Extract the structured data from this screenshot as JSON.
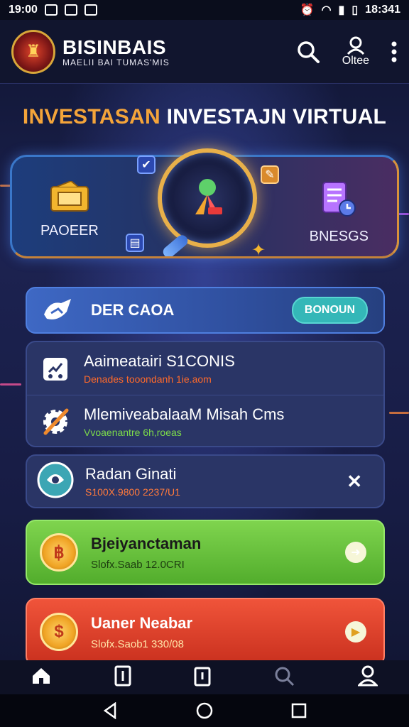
{
  "status_bar": {
    "time_left": "19:00",
    "time_right": "18:341"
  },
  "app_bar": {
    "brand_title": "BISINBAIS",
    "brand_subtitle": "MAELII BAI TUMAS'MIS",
    "profile_label": "Oltee"
  },
  "headline": {
    "part1": "INVESTASAN",
    "part2": " INVESTAJN VIRTUAL"
  },
  "hero": {
    "left_label": "PAOEER",
    "right_label": "BNESGS"
  },
  "feature_card": {
    "title": "DER CAOA",
    "button_label": "BONOUN"
  },
  "list": [
    {
      "title": "Aaimeatairi S1CONIS",
      "subtitle": "Denades tooondanh 1ie.aom",
      "subtitle_color": "#ff6a2a"
    },
    {
      "title": "MlemiveabalaaM Misah Cms",
      "subtitle": "Vvoaenantre 6h,roeas",
      "subtitle_color": "#7ddc4a"
    }
  ],
  "single_item": {
    "title": "Radan Ginati",
    "subtitle": "S100X.9800 2237/U1"
  },
  "green_card": {
    "title": "Bjeiyanctaman",
    "subtitle": "Slofx.Saab 12.0CRI"
  },
  "red_card": {
    "title": "Uaner Neabar",
    "subtitle": "Slofx.Saob1 330/08"
  },
  "tab_bar": [
    "home-icon",
    "document-icon",
    "clipboard-icon",
    "search-icon",
    "profile-icon"
  ],
  "colors": {
    "accent_orange": "#f4a43a",
    "green": "#52ad2c",
    "red": "#c9301e",
    "teal": "#34b7b8"
  }
}
